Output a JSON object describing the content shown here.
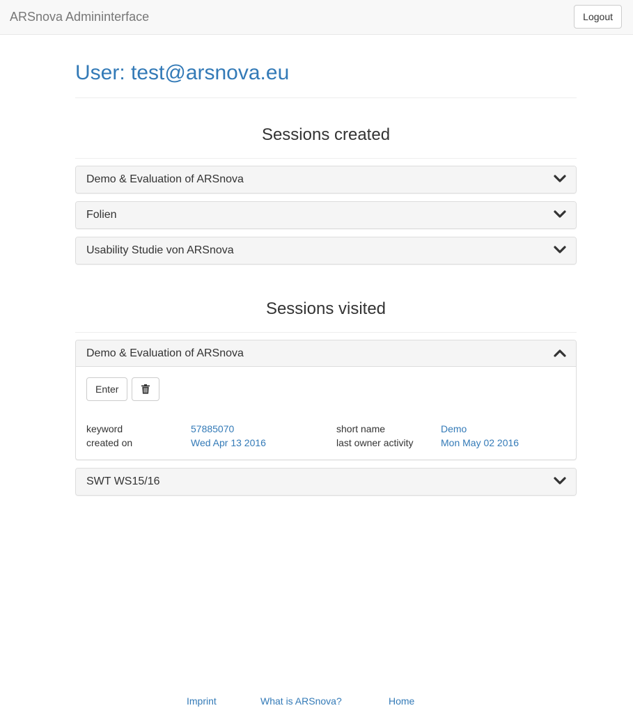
{
  "app": {
    "brand": "ARSnova Admininterface",
    "logout_label": "Logout"
  },
  "page": {
    "title": "User: test@arsnova.eu"
  },
  "sessions_created": {
    "heading": "Sessions created",
    "items": [
      {
        "title": "Demo & Evaluation of ARSnova"
      },
      {
        "title": "Folien"
      },
      {
        "title": "Usability Studie von ARSnova"
      }
    ]
  },
  "sessions_visited": {
    "heading": "Sessions visited",
    "open_item": {
      "title": "Demo & Evaluation of ARSnova",
      "enter_label": "Enter",
      "trash_icon": "trash-icon",
      "details": {
        "keyword_label": "keyword",
        "keyword_value": "57885070",
        "created_label": "created on",
        "created_value": "Wed Apr 13 2016",
        "short_name_label": "short name",
        "short_name_value": "Demo",
        "activity_label": "last owner activity",
        "activity_value": "Mon May 02 2016"
      }
    },
    "items": [
      {
        "title": "SWT WS15/16"
      }
    ]
  },
  "footer": {
    "links": [
      "Imprint",
      "What is ARSnova?",
      "Home"
    ]
  },
  "colors": {
    "link": "#337ab7",
    "navbar_bg": "#f8f8f8",
    "panel_heading_bg": "#f5f5f5"
  }
}
